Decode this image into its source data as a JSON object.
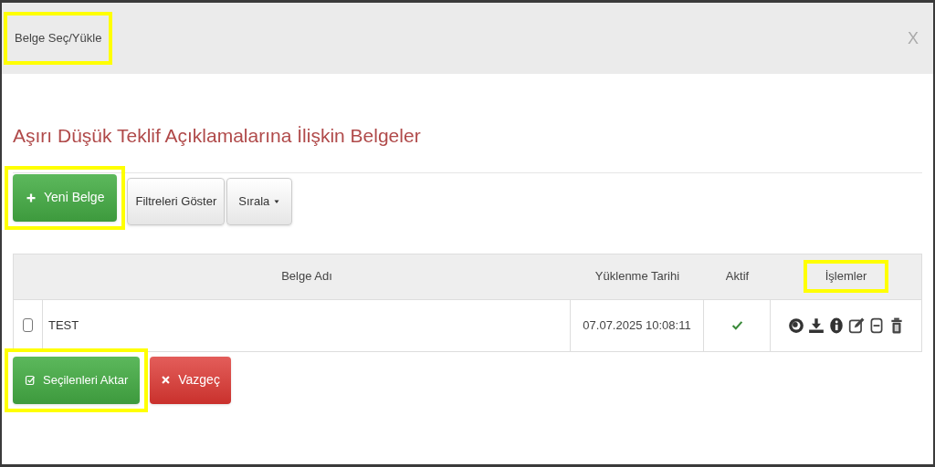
{
  "dialog": {
    "title": "Belge Seç/Yükle",
    "title_highlighted": true,
    "close": "X"
  },
  "heading": "Aşırı Düşük Teklif Açıklamalarına İlişkin Belgeler",
  "toolbar": [
    {
      "kind": "add",
      "label": "Yeni Belge",
      "highlighted": true
    },
    {
      "kind": "plain",
      "label": "Filtreleri Göster",
      "highlighted": false
    },
    {
      "kind": "dropdown",
      "label": "Sırala",
      "highlighted": false
    }
  ],
  "table": {
    "columns": [
      {
        "label": "Belge Adı",
        "highlighted": false
      },
      {
        "label": "Yüklenme Tarihi",
        "highlighted": false
      },
      {
        "label": "Aktif",
        "highlighted": false
      },
      {
        "label": "İşlemler",
        "highlighted": true
      }
    ],
    "rows": [
      {
        "checked": false,
        "name": "TEST",
        "date": "07.07.2025 10:08:11",
        "active": true,
        "actions": [
          {
            "kind": "view"
          },
          {
            "kind": "download"
          },
          {
            "kind": "info"
          },
          {
            "kind": "edit"
          },
          {
            "kind": "remove"
          },
          {
            "kind": "delete"
          }
        ]
      }
    ]
  },
  "footer": [
    {
      "kind": "confirm",
      "label": "Seçilenleri Aktar",
      "highlighted": true
    },
    {
      "kind": "cancel",
      "label": "Vazgeç",
      "highlighted": false
    }
  ]
}
